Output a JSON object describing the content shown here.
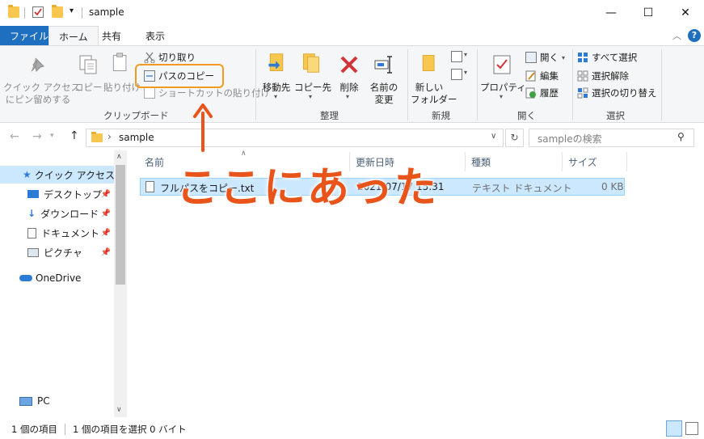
{
  "window": {
    "title": "sample",
    "minimize": "—",
    "maximize": "☐",
    "close": "✕"
  },
  "tabs": [
    "ファイル",
    "ホーム",
    "共有",
    "表示"
  ],
  "ribbon": {
    "clipboard": {
      "pin_label_1": "クイック アクセス",
      "pin_label_2": "にピン留めする",
      "copy": "コピー",
      "paste": "貼り付け",
      "cut": "切り取り",
      "copy_path": "パスのコピー",
      "paste_shortcut": "ショートカットの貼り付け",
      "group": "クリップボード"
    },
    "organize": {
      "move_to": "移動先",
      "copy_to": "コピー先",
      "delete": "削除",
      "rename_1": "名前の",
      "rename_2": "変更",
      "group": "整理"
    },
    "new": {
      "new_folder_1": "新しい",
      "new_folder_2": "フォルダー",
      "group": "新規"
    },
    "open": {
      "properties": "プロパティ",
      "open": "開く",
      "edit": "編集",
      "history": "履歴",
      "group": "開く"
    },
    "select": {
      "select_all": "すべて選択",
      "select_none": "選択解除",
      "invert": "選択の切り替え",
      "group": "選択"
    }
  },
  "address": {
    "path": "sample",
    "search_placeholder": "sampleの検索"
  },
  "nav": {
    "quick_access": "クイック アクセス",
    "items": [
      "デスクトップ",
      "ダウンロード",
      "ドキュメント",
      "ピクチャ"
    ],
    "onedrive": "OneDrive",
    "pc": "PC"
  },
  "columns": {
    "name": "名前",
    "date": "更新日時",
    "type": "種類",
    "size": "サイズ"
  },
  "files": [
    {
      "name": "フルパスをコピー.txt",
      "date": "2021/07/17 15:31",
      "type": "テキスト ドキュメント",
      "size": "0 KB"
    }
  ],
  "status": {
    "count": "1 個の項目",
    "selected": "1 個の項目を選択  0 バイト"
  },
  "annotation": {
    "text": "ここにあった"
  },
  "colors": {
    "accent": "#1f6fc0",
    "selection": "#cce8ff",
    "highlight_box": "#f29a1e",
    "annotation": "#e9541a"
  }
}
